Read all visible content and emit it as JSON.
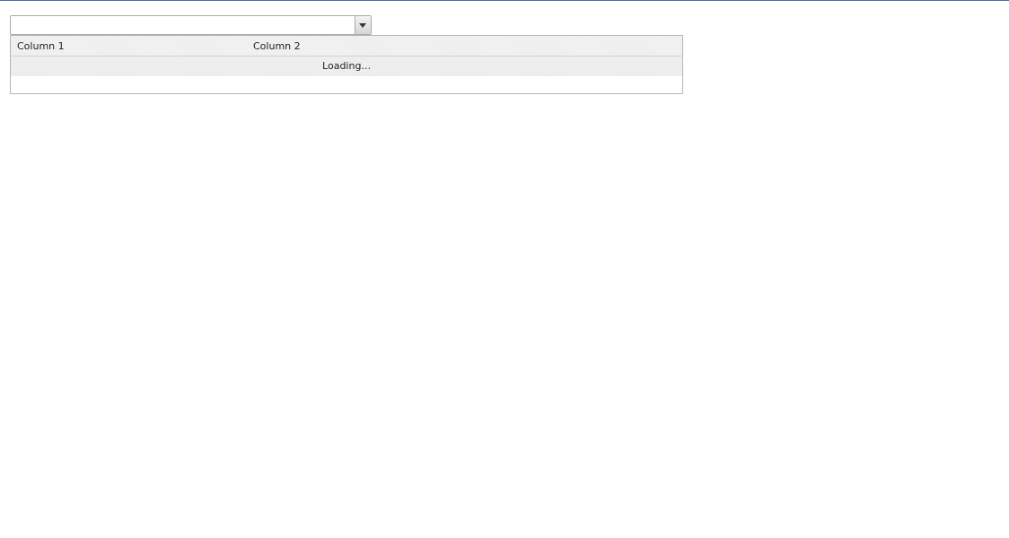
{
  "combobox": {
    "value": ""
  },
  "grid": {
    "columns": [
      "Column 1",
      "Column 2"
    ],
    "status_text": "Loading..."
  }
}
